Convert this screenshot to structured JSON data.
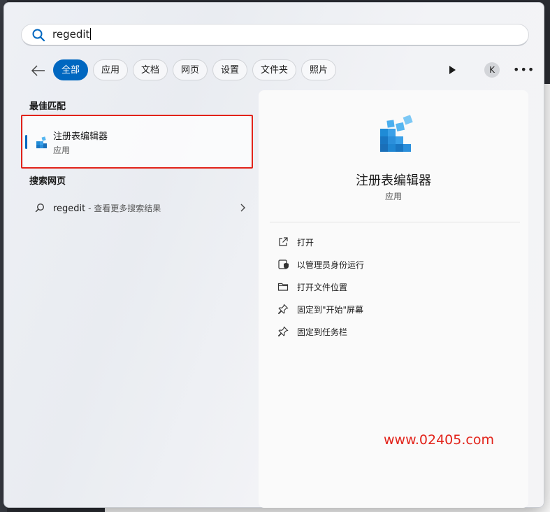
{
  "search": {
    "query": "regedit"
  },
  "filters": {
    "chips": [
      "全部",
      "应用",
      "文档",
      "网页",
      "设置",
      "文件夹",
      "照片"
    ],
    "active": "全部",
    "account_initial": "K"
  },
  "best_match": {
    "heading": "最佳匹配",
    "app_name": "注册表编辑器",
    "app_kind": "应用"
  },
  "web_search": {
    "heading": "搜索网页",
    "query": "regedit",
    "hint": " - 查看更多搜索结果"
  },
  "detail": {
    "title": "注册表编辑器",
    "subtitle": "应用",
    "actions": [
      "打开",
      "以管理员身份运行",
      "打开文件位置",
      "固定到\"开始\"屏幕",
      "固定到任务栏"
    ]
  },
  "watermark": "www.02405.com",
  "colors": {
    "accent": "#0067c0",
    "highlight": "#e2231a",
    "registry_icon": "#1f8bd6"
  },
  "icons": [
    "search-icon",
    "back-arrow-icon",
    "play-icon",
    "more-icon",
    "registry-icon",
    "open-icon",
    "admin-shield-icon",
    "folder-icon",
    "pin-icon",
    "chevron-right-icon"
  ]
}
